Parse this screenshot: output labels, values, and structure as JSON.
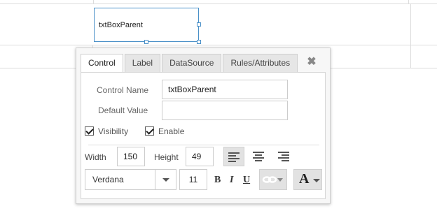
{
  "canvas": {
    "control_text": "txtBoxParent"
  },
  "popup": {
    "tabs": [
      {
        "label": "Control",
        "active": true
      },
      {
        "label": "Label",
        "active": false
      },
      {
        "label": "DataSource",
        "active": false
      },
      {
        "label": "Rules/Attributes",
        "active": false
      }
    ],
    "close_icon": "close-x",
    "fields": {
      "control_name": {
        "label": "Control Name",
        "value": "txtBoxParent"
      },
      "default_value": {
        "label": "Default Value",
        "value": ""
      }
    },
    "checkboxes": [
      {
        "label": "Visibility",
        "checked": true
      },
      {
        "label": "Enable",
        "checked": true
      }
    ],
    "width": {
      "label": "Width",
      "value": "150"
    },
    "height": {
      "label": "Height",
      "value": "49"
    },
    "alignment": {
      "options": [
        "align-left",
        "align-center",
        "align-right"
      ],
      "selected": "align-left"
    },
    "font": {
      "family": "Verdana",
      "size": "11"
    },
    "format": {
      "bold": "B",
      "italic": "I",
      "underline": "U",
      "font_color_glyph": "A"
    }
  },
  "colors": {
    "selection_border": "#4a90c8",
    "popup_bg": "#f7f7f7",
    "active_align_bg": "#e2e2e2"
  }
}
